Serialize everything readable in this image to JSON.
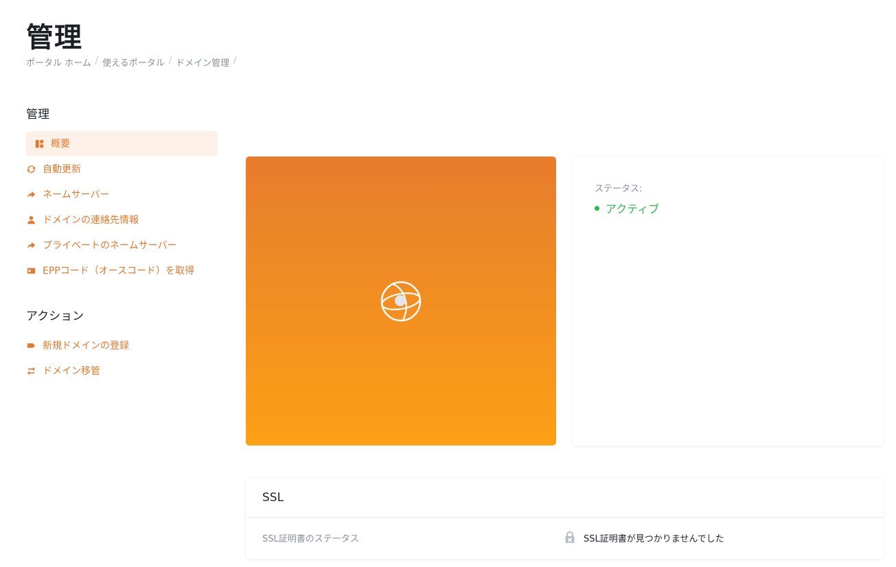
{
  "header": {
    "title": "管理",
    "breadcrumb": [
      "ポータル ホーム",
      "使えるポータル",
      "ドメイン管理"
    ],
    "breadcrumb_sep": "/"
  },
  "sidebar": {
    "manage_heading": "管理",
    "manage_items": [
      {
        "label": "概要",
        "icon": "dashboard-icon",
        "active": true
      },
      {
        "label": "自動更新",
        "icon": "refresh-icon"
      },
      {
        "label": "ネームサーバー",
        "icon": "share-arrow-icon"
      },
      {
        "label": "ドメインの連絡先情報",
        "icon": "user-icon"
      },
      {
        "label": "プライベートのネームサーバー",
        "icon": "share-arrow-icon"
      },
      {
        "label": "EPPコード（オースコード）を取得",
        "icon": "id-card-icon"
      }
    ],
    "actions_heading": "アクション",
    "action_items": [
      {
        "label": "新規ドメインの登録",
        "icon": "tag-icon"
      },
      {
        "label": "ドメイン移管",
        "icon": "exchange-icon"
      }
    ]
  },
  "status": {
    "label": "ステータス:",
    "value": "アクティブ",
    "color": "#2fb84a"
  },
  "ssl": {
    "title": "SSL",
    "row_label": "SSL証明書のステータス",
    "row_value": "SSL証明書が見つかりませんでした",
    "icon": "lock-icon"
  },
  "colors": {
    "accent": "#e07a2e",
    "hero_top": "#e77c2d",
    "hero_bottom": "#fda016"
  }
}
